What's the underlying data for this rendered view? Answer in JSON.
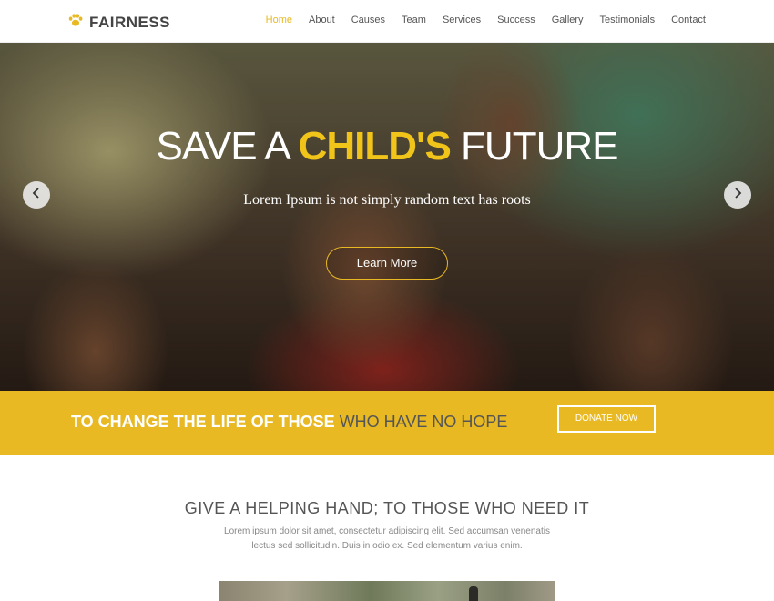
{
  "header": {
    "brand": "FAIRNESS",
    "nav": [
      "Home",
      "About",
      "Causes",
      "Team",
      "Services",
      "Success",
      "Gallery",
      "Testimonials",
      "Contact"
    ],
    "active": "Home"
  },
  "hero": {
    "title_pre": "SAVE A ",
    "title_highlight": "CHILD'S",
    "title_post": " FUTURE",
    "subtitle": "Lorem Ipsum is not simply random text has roots",
    "button": "Learn More"
  },
  "banner": {
    "text_bold": "TO CHANGE THE LIFE OF THOSE",
    "text_light": " WHO HAVE NO HOPE",
    "button": "DONATE NOW"
  },
  "section": {
    "title": "GIVE A HELPING HAND; TO THOSE WHO NEED IT",
    "text": "Lorem ipsum dolor sit amet, consectetur adipiscing elit. Sed accumsan venenatis lectus sed sollicitudin. Duis in odio ex. Sed elementum varius enim."
  },
  "colors": {
    "accent": "#e8b923"
  }
}
